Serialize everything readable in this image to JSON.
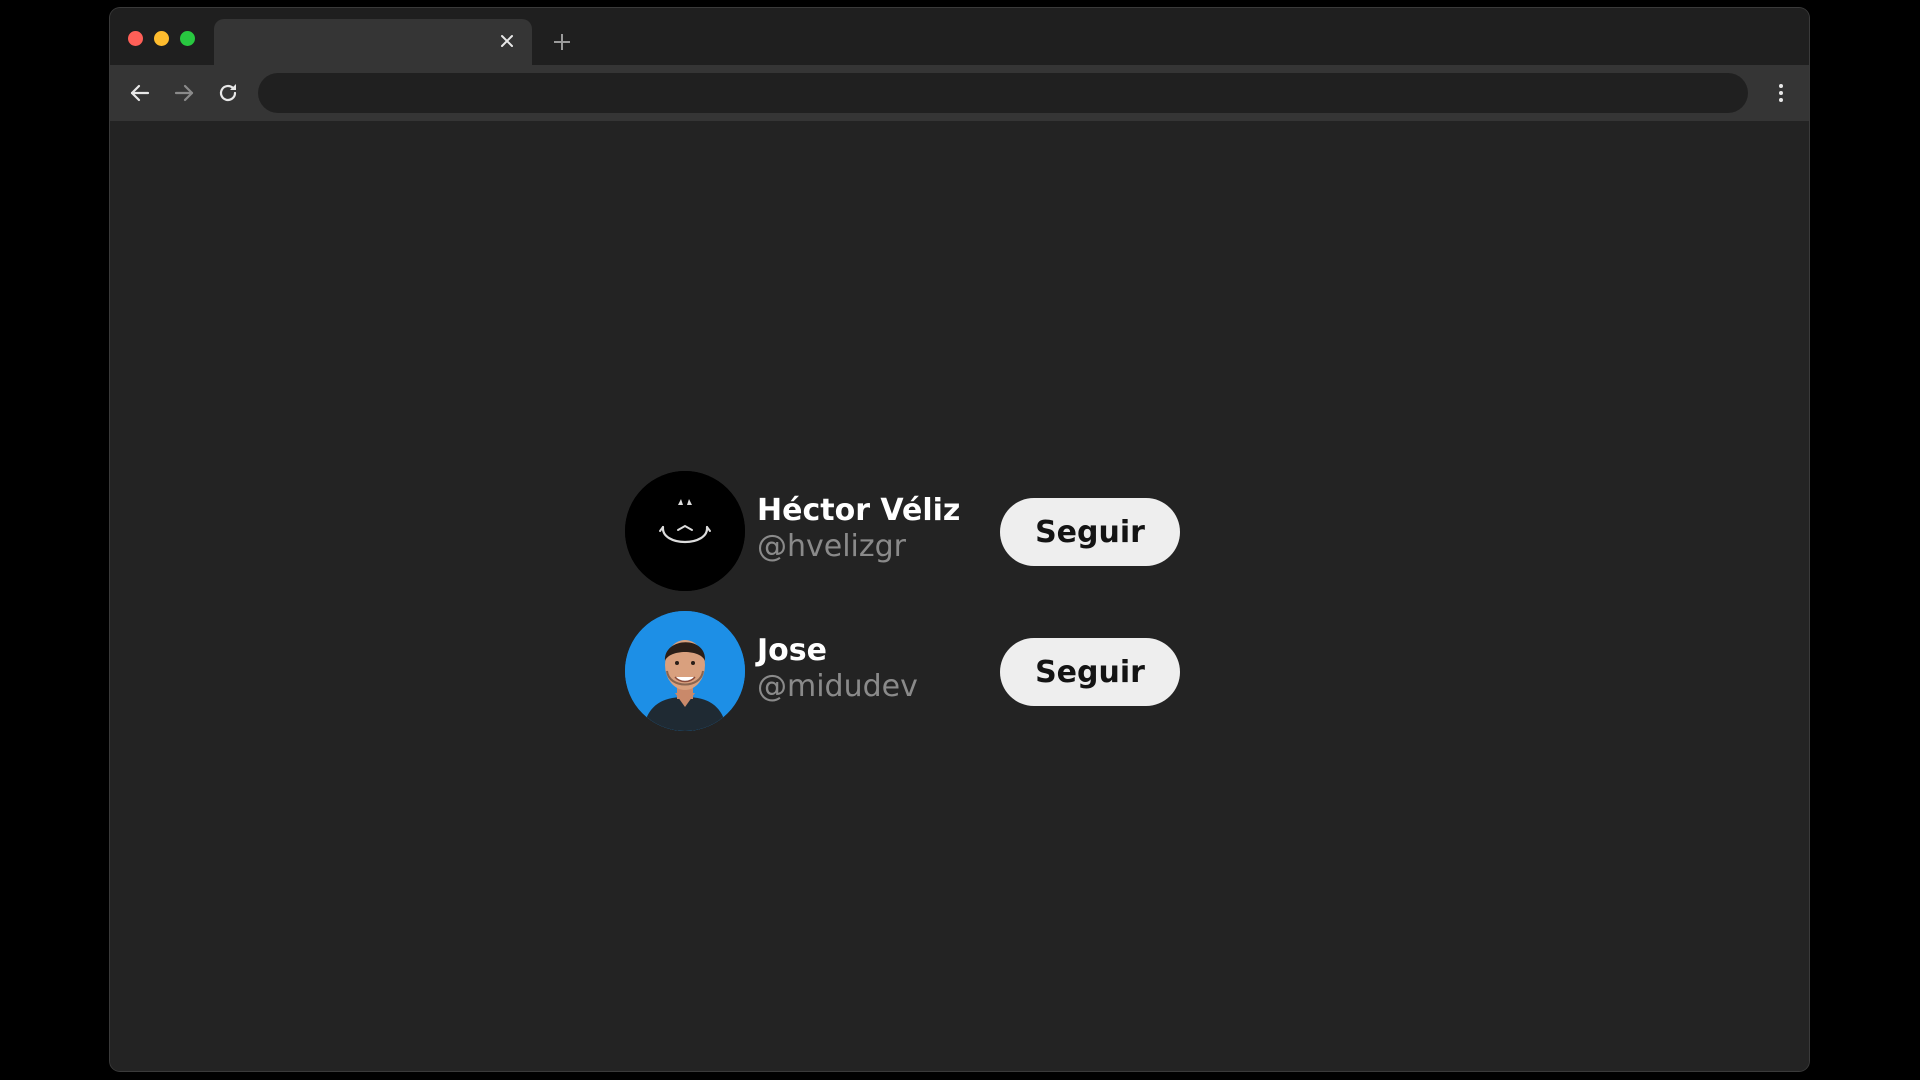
{
  "window": {
    "traffic_colors": {
      "close": "#ff5f57",
      "minimize": "#febc2e",
      "maximize": "#28c840"
    },
    "tab": {
      "title": "",
      "close_icon": "close-icon"
    },
    "new_tab_icon": "plus-icon"
  },
  "toolbar": {
    "back_icon": "arrow-left-icon",
    "forward_icon": "arrow-right-icon",
    "reload_icon": "reload-icon",
    "address_value": "",
    "menu_icon": "kebab-menu-icon"
  },
  "users": [
    {
      "name": "Héctor Véliz",
      "handle": "@hvelizgr",
      "button_label": "Seguir",
      "avatar_icon": "skull-avatar-icon",
      "avatar_bg": "#000000"
    },
    {
      "name": "Jose",
      "handle": "@midudev",
      "button_label": "Seguir",
      "avatar_icon": "person-avatar-icon",
      "avatar_bg": "#1d8fe6"
    }
  ],
  "colors": {
    "page_bg": "#232323",
    "name_text": "#ffffff",
    "handle_text": "#8a8a8a",
    "button_bg": "#eeeeee",
    "button_text": "#141414"
  }
}
